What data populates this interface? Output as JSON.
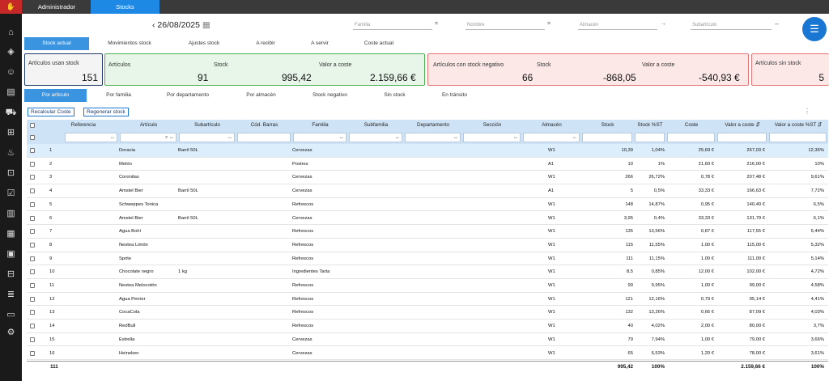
{
  "topbar": {
    "tab_admin": "Administrador",
    "tab_stocks": "Stocks"
  },
  "sidebar": {
    "icons": [
      "home-icon",
      "tag-icon",
      "users-icon",
      "chart-icon",
      "truck-icon",
      "cart-icon",
      "chef-icon",
      "delivery-icon",
      "checklist-icon",
      "bar-chart-icon",
      "factory-icon",
      "calendar-icon",
      "shopping-cart-icon",
      "receipt-icon",
      "document-icon",
      "settings-icon"
    ]
  },
  "date": {
    "prev": "‹",
    "value": "26/08/2025",
    "calendar": "▦"
  },
  "filters": {
    "familia": {
      "placeholder": "Familia",
      "op": "="
    },
    "nombre": {
      "placeholder": "Nombre",
      "op": "="
    },
    "almacen": {
      "placeholder": "Almacén",
      "op": "→"
    },
    "subarticulo": {
      "placeholder": "Subartículo",
      "op": "↔"
    }
  },
  "menu_button": "☰",
  "tabs_main": [
    "Stock actual",
    "Movimientos stock",
    "Ajustes stock",
    "A recibir",
    "A servir",
    "Coste actual"
  ],
  "cards": {
    "usan_stock": {
      "label": "Artículos usan stock",
      "value": "151"
    },
    "articulos": {
      "label_art": "Artículos",
      "label_stock": "Stock",
      "label_valor": "Valor a coste",
      "art": "91",
      "stock": "995,42",
      "valor": "2.159,66 €"
    },
    "negativo": {
      "label_art": "Artículos con stock negativo",
      "label_stock": "Stock",
      "label_valor": "Valor a coste",
      "art": "66",
      "stock": "-868,05",
      "valor": "-540,93 €"
    },
    "sin_stock": {
      "label": "Artículos sin stock",
      "value": "5"
    }
  },
  "tabs_sub": [
    "Por artículo",
    "Por familia",
    "Por departamento",
    "Por almacén",
    "Stock negativo",
    "Sin stock",
    "En tránsito"
  ],
  "actions": {
    "recalcular": "Recalcular Coste",
    "regenerar": "Regenerar stock",
    "more": "⋮"
  },
  "table": {
    "headers": [
      "Referencia",
      "Artículo",
      "Subartículo",
      "Cód. Barras",
      "Familia",
      "Subfamilia",
      "Departamento",
      "Sección",
      "Almacén",
      "Stock",
      "Stock %ST",
      "Coste",
      "Valor a coste ⇵",
      "Valor a coste %ST ⇵"
    ],
    "filter_icons": {
      "arrows": "↔",
      "search": "⌕"
    },
    "rows": [
      [
        "1",
        "Doracia",
        "Barril 50L",
        "",
        "Cervezas",
        "",
        "",
        "",
        "W1",
        "10,39",
        "1,04%",
        "25,69 €",
        "267,03 €",
        "12,36%"
      ],
      [
        "2",
        "Melón",
        "",
        "",
        "Postres",
        "",
        "",
        "",
        "A1",
        "10",
        "1%",
        "21,60 €",
        "216,00 €",
        "10%"
      ],
      [
        "3",
        "Coronitas",
        "",
        "",
        "Cervezas",
        "",
        "",
        "",
        "W1",
        "266",
        "26,72%",
        "0,78 €",
        "207,48 €",
        "9,61%"
      ],
      [
        "4",
        "Amstel Bier",
        "Barril 50L",
        "",
        "Cervezas",
        "",
        "",
        "",
        "A1",
        "5",
        "0,5%",
        "33,33 €",
        "166,63 €",
        "7,72%"
      ],
      [
        "5",
        "Schweppes Tonica",
        "",
        "",
        "Refrescos",
        "",
        "",
        "",
        "W1",
        "148",
        "14,87%",
        "0,95 €",
        "140,40 €",
        "6,5%"
      ],
      [
        "6",
        "Amstel Bier",
        "Barril 50L",
        "",
        "Cervezas",
        "",
        "",
        "",
        "W1",
        "3,95",
        "0,4%",
        "33,33 €",
        "131,79 €",
        "6,1%"
      ],
      [
        "7",
        "Agua Bohí",
        "",
        "",
        "Refrescos",
        "",
        "",
        "",
        "W1",
        "135",
        "13,56%",
        "0,87 €",
        "117,55 €",
        "5,44%"
      ],
      [
        "8",
        "Nestea Limón",
        "",
        "",
        "Refrescos",
        "",
        "",
        "",
        "W1",
        "115",
        "11,55%",
        "1,00 €",
        "115,00 €",
        "5,32%"
      ],
      [
        "9",
        "Sprite",
        "",
        "",
        "Refrescos",
        "",
        "",
        "",
        "W1",
        "111",
        "11,15%",
        "1,00 €",
        "111,00 €",
        "5,14%"
      ],
      [
        "10",
        "Chocolate negro",
        "1 kg",
        "",
        "Ingredientes Tarta",
        "",
        "",
        "",
        "W1",
        "8,5",
        "0,85%",
        "12,00 €",
        "102,00 €",
        "4,72%"
      ],
      [
        "11",
        "Nestea Melocotón",
        "",
        "",
        "Refrescos",
        "",
        "",
        "",
        "W1",
        "99",
        "9,95%",
        "1,00 €",
        "99,00 €",
        "4,58%"
      ],
      [
        "12",
        "Agua Perrier",
        "",
        "",
        "Refrescos",
        "",
        "",
        "",
        "W1",
        "121",
        "12,16%",
        "0,79 €",
        "95,14 €",
        "4,41%"
      ],
      [
        "13",
        "CocaCola",
        "",
        "",
        "Refrescos",
        "",
        "",
        "",
        "W1",
        "132",
        "13,26%",
        "0,66 €",
        "87,09 €",
        "4,03%"
      ],
      [
        "14",
        "RedBull",
        "",
        "",
        "Refrescos",
        "",
        "",
        "",
        "W1",
        "40",
        "4,02%",
        "2,00 €",
        "80,00 €",
        "3,7%"
      ],
      [
        "15",
        "Estrella",
        "",
        "",
        "Cervezas",
        "",
        "",
        "",
        "W1",
        "79",
        "7,94%",
        "1,00 €",
        "79,00 €",
        "3,66%"
      ],
      [
        "16",
        "Heineken",
        "",
        "",
        "Cervezas",
        "",
        "",
        "",
        "W1",
        "65",
        "6,53%",
        "1,20 €",
        "78,00 €",
        "3,61%"
      ]
    ],
    "footer": {
      "count": "111",
      "stock": "995,42",
      "stock_pct": "100%",
      "valor": "2.159,66 €",
      "valor_pct": "100%"
    }
  }
}
